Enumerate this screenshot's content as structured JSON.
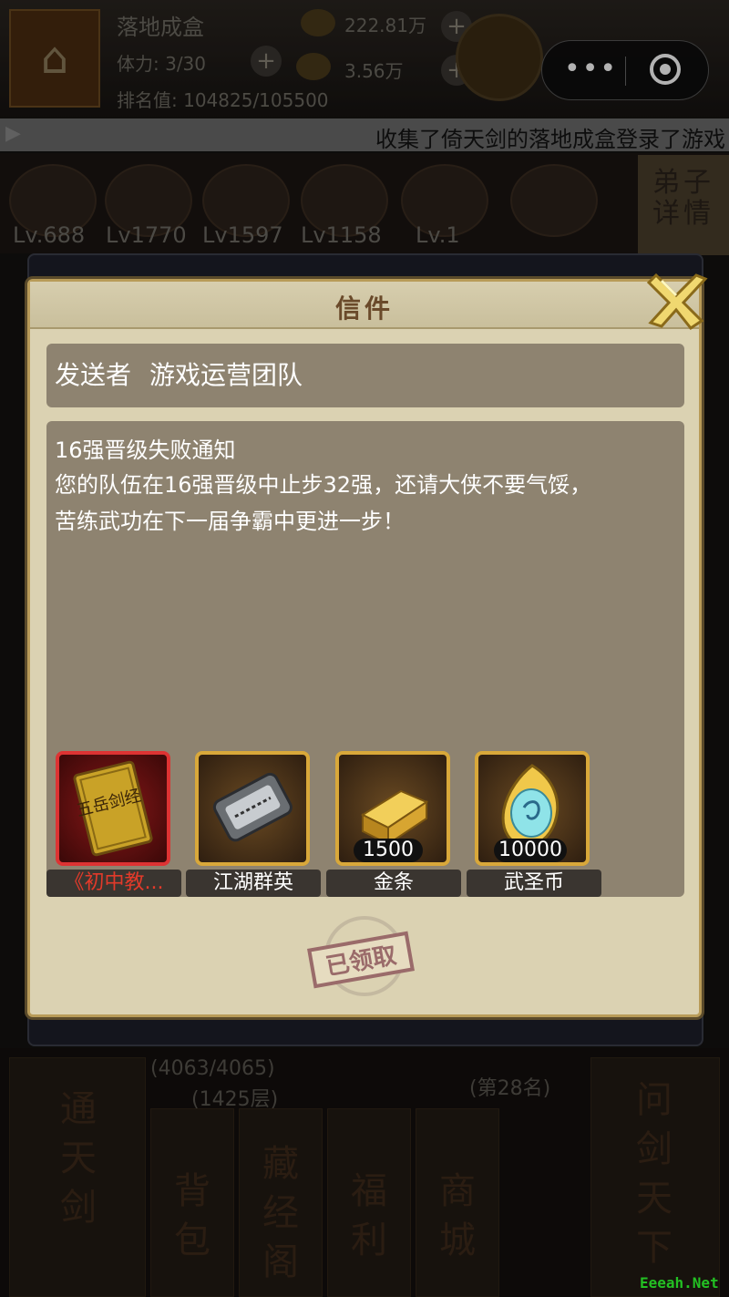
{
  "background": {
    "player_name": "落地成盒",
    "stamina": "体力: 3/30",
    "ranking": "排名值: 104825/105500",
    "silver": "222.81万",
    "gold": "3.56万",
    "marquee": "收集了倚天剑的落地成盒登录了游戏",
    "hero_levels": [
      "Lv.688",
      "Lv1770",
      "Lv1597",
      "Lv1158",
      "Lv.1"
    ],
    "disciple_button": "弟子详情",
    "stars": "(4063/4065)",
    "stars_sub": "(1425层)",
    "rank_text": "(第28名)",
    "bottom_menu": [
      "通天剑",
      "背包",
      "藏经阁",
      "福利",
      "商城",
      "问剑天下"
    ]
  },
  "dialog": {
    "title": "信件",
    "sender_label": "发送者",
    "sender_name": "游戏运营团队",
    "subject": "16强晋级失败通知",
    "body_lines": [
      "您的队伍在16强晋级中止步32强，还请大侠不要气馁，",
      "苦练武功在下一届争霸中更进一步！"
    ],
    "attachments": [
      {
        "name": "《初中教...",
        "quantity": "",
        "icon": "book-icon",
        "rarity": "red"
      },
      {
        "name": "江湖群英",
        "quantity": "",
        "icon": "token-icon",
        "rarity": "gold"
      },
      {
        "name": "金条",
        "quantity": "1500",
        "icon": "gold-bar-icon",
        "rarity": "gold"
      },
      {
        "name": "武圣币",
        "quantity": "10000",
        "icon": "crystal-coin-icon",
        "rarity": "gold"
      }
    ],
    "book_cover_text": "五岳剑经",
    "stamp_text": "已领取"
  },
  "watermark": "Eeeah.Net",
  "colors": {
    "dialog_bg": "#dbd2b2",
    "panel_bg": "#8e8370",
    "gold_border": "#d9a83a",
    "red_border": "#dd3333",
    "stamp": "#9a6b6a"
  }
}
